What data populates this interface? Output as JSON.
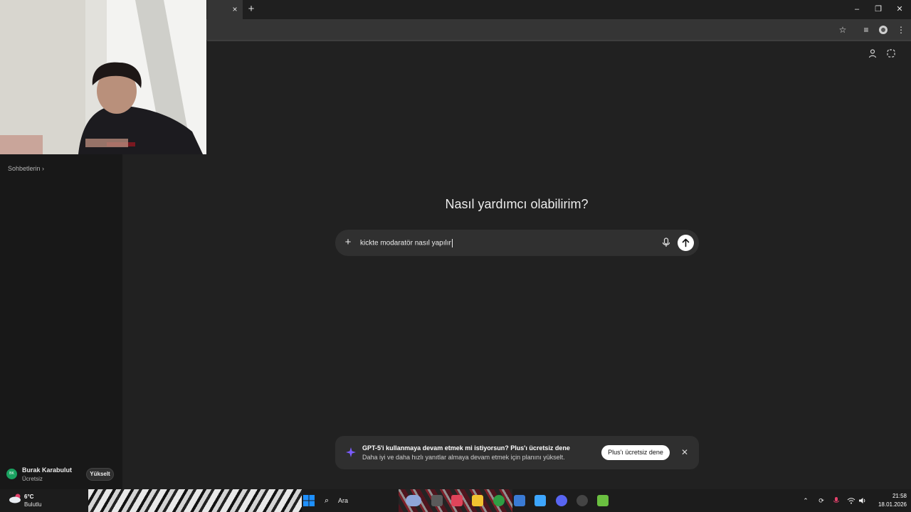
{
  "browser": {
    "tab_close": "×",
    "new_tab": "+",
    "window_controls": {
      "minimize": "–",
      "maximize": "❐",
      "close": "✕"
    },
    "toolbar_icons": [
      "star-icon",
      "media-icon",
      "extension-icon",
      "menu-icon"
    ]
  },
  "sidebar": {
    "chats_link": "Sohbetlerin ›",
    "user": {
      "initials": "BK",
      "name": "Burak Karabulut",
      "plan": "Ücretsiz",
      "upgrade_label": "Yükselt"
    }
  },
  "main": {
    "heading": "Nasıl yardımcı olabilirim?",
    "composer": {
      "value": "kickte modaratör nasıl yapılır",
      "plus_glyph": "+"
    }
  },
  "banner": {
    "title": "GPT-5'i kullanmaya devam etmek mi istiyorsun? Plus'ı ücretsiz dene",
    "subtitle": "Daha iyi ve daha hızlı yanıtlar almaya devam etmek için planını yükselt.",
    "cta": "Plus'ı ücretsiz dene",
    "close": "✕"
  },
  "taskbar": {
    "weather_temp": "6°C",
    "weather_desc": "Bulutlu",
    "search_label": "Ara",
    "time": "21:58",
    "date": "18.01.2026"
  },
  "colors": {
    "background": "#212121",
    "sidebar": "#181818",
    "composer": "#303030",
    "avatar": "#1aa260",
    "spark": "#7b5cff"
  }
}
